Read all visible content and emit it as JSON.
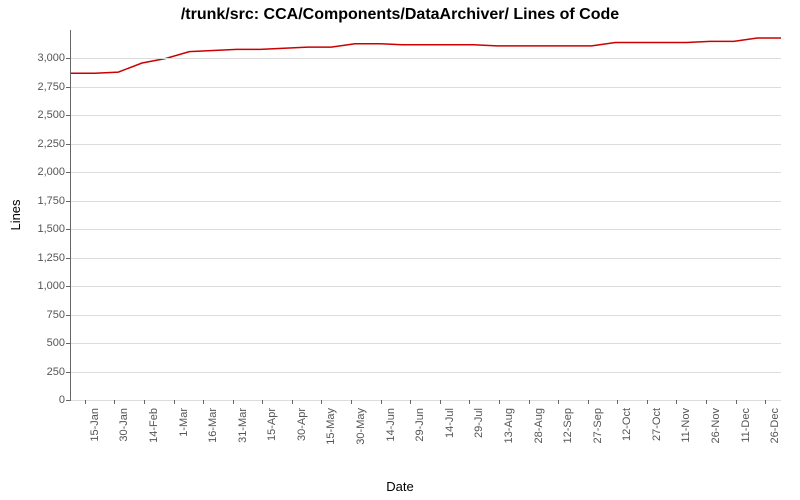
{
  "chart_data": {
    "type": "line",
    "title": "/trunk/src: CCA/Components/DataArchiver/ Lines of Code",
    "xlabel": "Date",
    "ylabel": "Lines",
    "ylim": [
      0,
      3250
    ],
    "y_ticks": [
      0,
      250,
      500,
      750,
      1000,
      1250,
      1500,
      1750,
      2000,
      2250,
      2500,
      2750,
      3000
    ],
    "x_ticks": [
      "15-Jan",
      "30-Jan",
      "14-Feb",
      "1-Mar",
      "16-Mar",
      "31-Mar",
      "15-Apr",
      "30-Apr",
      "15-May",
      "30-May",
      "14-Jun",
      "29-Jun",
      "14-Jul",
      "29-Jul",
      "13-Aug",
      "28-Aug",
      "12-Sep",
      "27-Sep",
      "12-Oct",
      "27-Oct",
      "11-Nov",
      "26-Nov",
      "11-Dec",
      "26-Dec"
    ],
    "series": [
      {
        "name": "Lines of Code",
        "color": "#cc0000",
        "x": [
          "8-Jan",
          "15-Jan",
          "22-Jan",
          "28-Jan",
          "30-Jan",
          "5-Feb",
          "14-Feb",
          "1-Mar",
          "16-Mar",
          "31-Mar",
          "15-Apr",
          "28-Apr",
          "30-Apr",
          "15-May",
          "30-May",
          "14-Jun",
          "29-Jun",
          "14-Jul",
          "29-Jul",
          "13-Aug",
          "28-Aug",
          "12-Sep",
          "27-Sep",
          "10-Oct",
          "12-Oct",
          "27-Oct",
          "11-Nov",
          "26-Nov",
          "11-Dec",
          "22-Dec",
          "26-Dec"
        ],
        "values": [
          2870,
          2870,
          2880,
          2960,
          3000,
          3060,
          3070,
          3080,
          3080,
          3090,
          3100,
          3100,
          3130,
          3130,
          3120,
          3120,
          3120,
          3120,
          3110,
          3110,
          3110,
          3110,
          3110,
          3140,
          3140,
          3140,
          3140,
          3150,
          3150,
          3180,
          3180
        ]
      }
    ]
  }
}
